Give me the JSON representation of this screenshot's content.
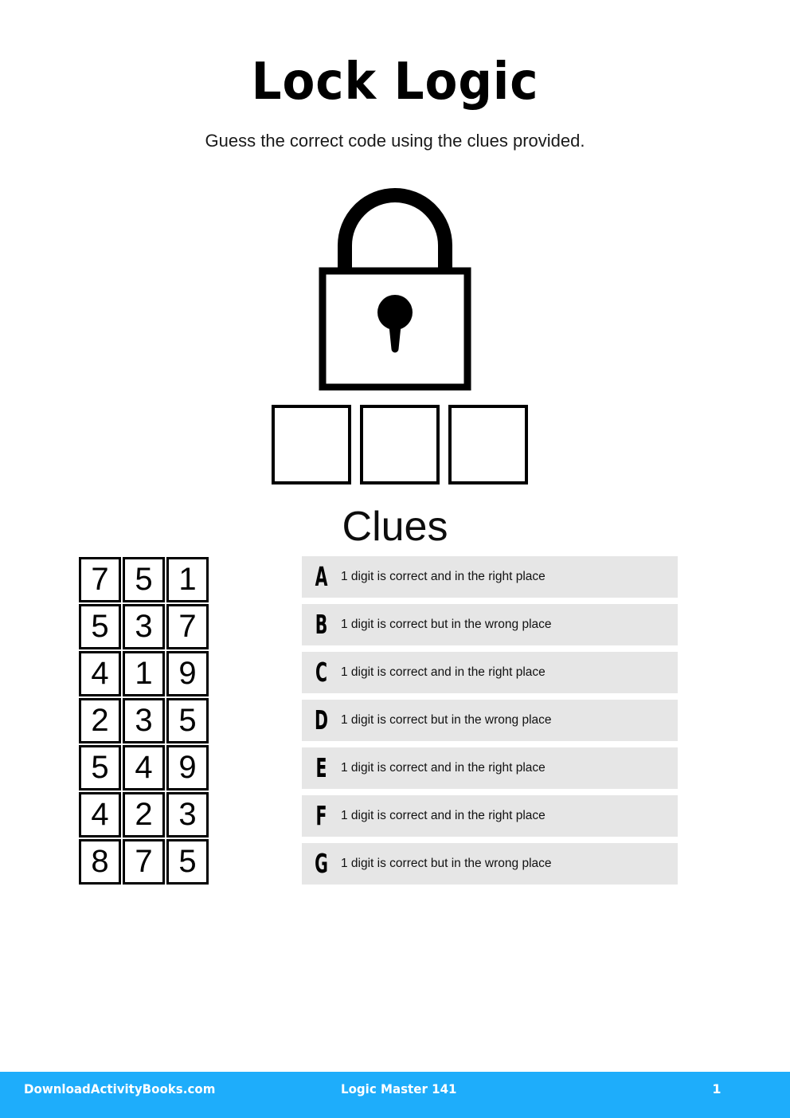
{
  "header": {
    "title": "Lock Logic",
    "subtitle": "Guess the correct code using the clues provided."
  },
  "lock": {
    "icon": "padlock-icon",
    "color": "#000000"
  },
  "answer": {
    "boxes": [
      "",
      "",
      ""
    ]
  },
  "clues_section": {
    "heading": "Clues",
    "row_background": "#e6e6e6",
    "items": [
      {
        "letter": "A",
        "text": "1 digit is correct and in the right place"
      },
      {
        "letter": "B",
        "text": "1 digit is correct but in the wrong place"
      },
      {
        "letter": "C",
        "text": "1 digit is correct and in the right place"
      },
      {
        "letter": "D",
        "text": "1 digit is correct but in the wrong place"
      },
      {
        "letter": "E",
        "text": "1 digit is correct and in the right place"
      },
      {
        "letter": "F",
        "text": "1 digit is correct and in the right place"
      },
      {
        "letter": "G",
        "text": "1 digit is correct but in the wrong place"
      }
    ]
  },
  "guesses": {
    "rows": [
      [
        "7",
        "5",
        "1"
      ],
      [
        "5",
        "3",
        "7"
      ],
      [
        "4",
        "1",
        "9"
      ],
      [
        "2",
        "3",
        "5"
      ],
      [
        "5",
        "4",
        "9"
      ],
      [
        "4",
        "2",
        "3"
      ],
      [
        "8",
        "7",
        "5"
      ]
    ]
  },
  "footer": {
    "site": "DownloadActivityBooks.com",
    "book": "Logic Master 141",
    "page": "1",
    "background": "#1eadfb",
    "text_color": "#ffffff"
  }
}
